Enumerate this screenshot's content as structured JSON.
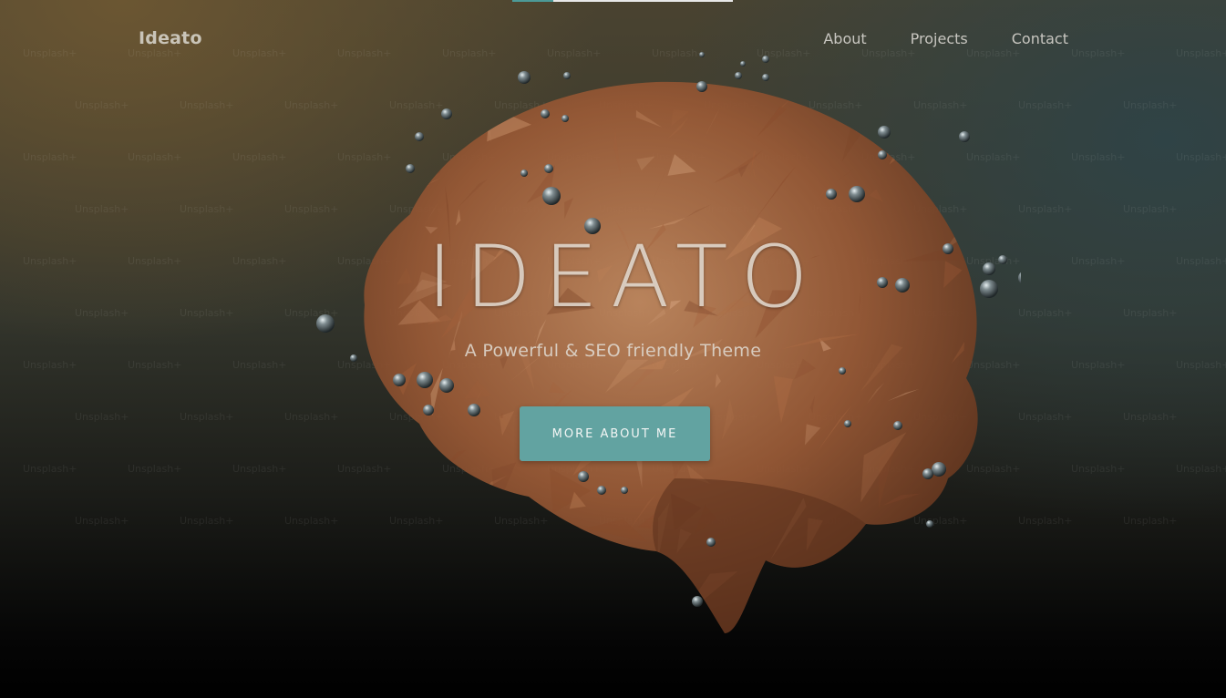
{
  "brand": {
    "name": "Ideato"
  },
  "nav": {
    "links": [
      {
        "label": "About"
      },
      {
        "label": "Projects"
      },
      {
        "label": "Contact"
      }
    ]
  },
  "hero": {
    "title": "IDEATO",
    "subtitle": "A Powerful & SEO friendly Theme",
    "cta_label": "MORE ABOUT ME",
    "background_image": "low-poly-brain-with-floating-spheres",
    "watermark_text": "Unsplash+"
  },
  "colors": {
    "accent": "#62a3a1",
    "brain_light": "#c98a5e",
    "brain_dark": "#6a3a22",
    "text_light": "#e6e0d6"
  }
}
